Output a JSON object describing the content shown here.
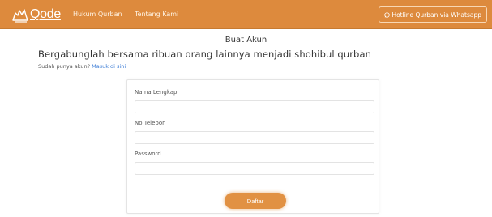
{
  "navbar": {
    "brand": "Qode",
    "links": [
      "Hukum Qurban",
      "Tentang Kami"
    ],
    "hotline_label": "Hotline Qurban via Whatsapp",
    "background": "#dd8a3d"
  },
  "page": {
    "title": "Buat Akun",
    "headline": "Bergabunglah bersama ribuan orang lainnya menjadi shohibul qurban",
    "login_prompt": "Sudah punya akun?",
    "login_link": "Masuk di sini"
  },
  "form": {
    "fields": [
      {
        "label": "Nama Lengkap",
        "value": ""
      },
      {
        "label": "No Telepon",
        "value": ""
      },
      {
        "label": "Password",
        "value": ""
      }
    ],
    "submit_label": "Daftar",
    "accent": "#e19143"
  }
}
